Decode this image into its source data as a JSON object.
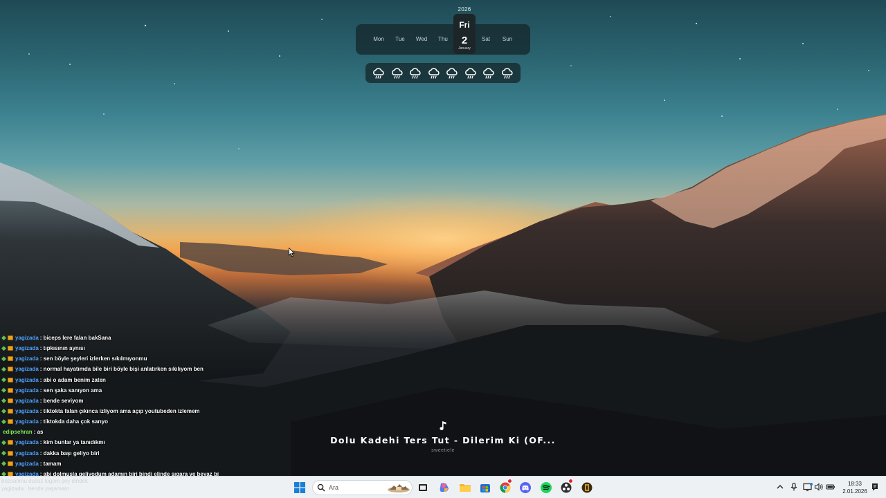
{
  "calendar": {
    "year": "2026",
    "days": [
      "Mon",
      "Tue",
      "Wed",
      "Thu",
      "Sat",
      "Sun"
    ],
    "today_weekday": "Fri",
    "today_date": "2",
    "today_month": "January"
  },
  "weather": {
    "icon": "cloud-rain-icon",
    "days_shown": 8
  },
  "chat": {
    "messages": [
      {
        "user": "yagizada",
        "text": ": biceps lere falan bakSana",
        "badges": true
      },
      {
        "user": "yagizada",
        "text": ": tıpkısının aynısı",
        "badges": true
      },
      {
        "user": "yagizada",
        "text": ": sen böyle şeyleri izlerken sıkılmıyonmu",
        "badges": true
      },
      {
        "user": "yagizada",
        "text": ": normal hayatımda bile biri böyle bişi anlatırken sıkılıyom ben",
        "badges": true
      },
      {
        "user": "yagizada",
        "text": ": abi o adam benim zaten",
        "badges": true
      },
      {
        "user": "yagizada",
        "text": ": sen şaka sanıyon ama",
        "badges": true
      },
      {
        "user": "yagizada",
        "text": ": bende seviyom",
        "badges": true
      },
      {
        "user": "yagizada",
        "text": ": tiktokta falan çıkınca izliyom ama açıp youtubeden izlemem",
        "badges": true
      },
      {
        "user": "yagizada",
        "text": ": tiktokda daha çok sarıyo",
        "badges": true
      },
      {
        "user": "edipsehran",
        "text": ": as",
        "badges": false
      },
      {
        "user": "yagizada",
        "text": ": kim bunlar ya tanıdıkmı",
        "badges": true
      },
      {
        "user": "yagizada",
        "text": ": dakka başı geliyo biri",
        "badges": true
      },
      {
        "user": "yagizada",
        "text": ": tamam",
        "badges": true
      },
      {
        "user": "yagizada",
        "text": ": abi dolmuşla geliyodum adamın biri bindi elinde sıgara ve beyaz bi",
        "badges": true
      }
    ],
    "ghost_lines": [
      "bozsanmu dusuz logom şey dindek",
      "yagizada : bende yaşamam"
    ]
  },
  "now_playing": {
    "title": "Dolu Kadehi Ters Tut - Dilerim Ki (OF...",
    "artist": "sweetiele"
  },
  "taskbar": {
    "search_placeholder": "Ara",
    "apps": [
      "windows-start-icon",
      "file-explorer-icon",
      "copilot-icon",
      "folder-icon",
      "store-icon",
      "chrome-icon",
      "discord-icon",
      "spotify-icon",
      "obs-icon",
      "game-icon"
    ],
    "clock_time": "18:33",
    "clock_date": "2.01.2026",
    "chrome_badge": "Y"
  }
}
